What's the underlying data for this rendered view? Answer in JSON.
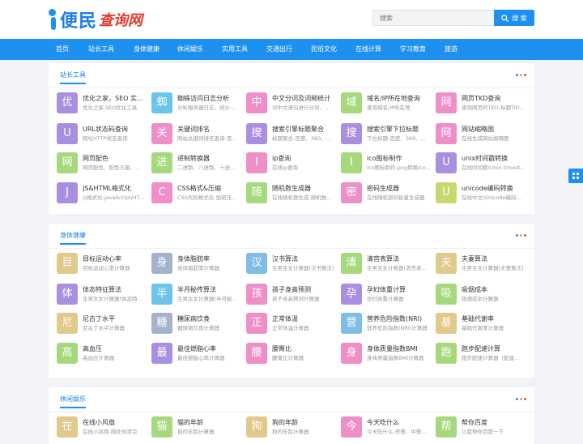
{
  "brand": {
    "logo_part1": "便民",
    "logo_part2": "查询网"
  },
  "search": {
    "placeholder": "搜索",
    "button_label": "搜 索"
  },
  "nav": [
    "首页",
    "站长工具",
    "身体健康",
    "休闲娱乐",
    "实用工具",
    "交通出行",
    "民俗文化",
    "在线计算",
    "学习教育",
    "旅游"
  ],
  "colors": {
    "primary": "#1e90f0",
    "dot1": "#1e90f0",
    "dot2": "#f5a623",
    "dot3": "#e84c3d"
  },
  "sections": [
    {
      "title": "站长工具",
      "items": [
        {
          "glyph": "优",
          "color": "#a98fe0",
          "name": "优化之家，SEO 实...",
          "desc": "优化之家,SEO优化工具"
        },
        {
          "glyph": "蜘",
          "color": "#6cc4e8",
          "name": "蜘蛛访问日志分析",
          "desc": "分析服务器日志，统计..."
        },
        {
          "glyph": "中",
          "color": "#ee8fc8",
          "name": "中文分词及词频统计",
          "desc": "对中文语句进行分词，..."
        },
        {
          "glyph": "域",
          "color": "#a6d87e",
          "name": "域名/IP所在地查询",
          "desc": "查询域名/IP所在地"
        },
        {
          "glyph": "网",
          "color": "#ee8fc8",
          "name": "网页TKD查询",
          "desc": "查询网页的TKD-标题Titl..."
        },
        {
          "glyph": "U",
          "color": "#a98fe0",
          "name": "URL状态码查询",
          "desc": "网址HTTP状态查询"
        },
        {
          "glyph": "关",
          "color": "#ee8fc8",
          "name": "关键词排名",
          "desc": "网站关键词排名查询-百..."
        },
        {
          "glyph": "搜",
          "color": "#a98fe0",
          "name": "搜索引擎标题聚合",
          "desc": "标题聚合-百度、360、..."
        },
        {
          "glyph": "搜",
          "color": "#a98fe0",
          "name": "搜索引擎下拉标题",
          "desc": "下拉标题-百度、360、..."
        },
        {
          "glyph": "网",
          "color": "#ee8fc8",
          "name": "网站缩略图",
          "desc": "在线生成网站缩略图"
        },
        {
          "glyph": "网",
          "color": "#a6d87e",
          "name": "网页配色",
          "desc": "网页配色、配色方案、..."
        },
        {
          "glyph": "进",
          "color": "#a6d87e",
          "name": "进制转换器",
          "desc": "二进制、八进制、十进..."
        },
        {
          "glyph": "I",
          "color": "#ee8fc8",
          "name": "ip查询",
          "desc": "在线ip查询"
        },
        {
          "glyph": "I",
          "color": "#a6d87e",
          "name": "ico图标制作",
          "desc": "ico图标制作-png转换ico..."
        },
        {
          "glyph": "U",
          "color": "#a98fe0",
          "name": "unix时间戳转换",
          "desc": "在线时间戳(Unix timest..."
        },
        {
          "glyph": "J",
          "color": "#a98fe0",
          "name": "JS&HTML格式化",
          "desc": "js格式化-JavaScript/HT..."
        },
        {
          "glyph": "C",
          "color": "#ee8fc8",
          "name": "CSS格式&压缩",
          "desc": "CSS代码格式化-加密压..."
        },
        {
          "glyph": "随",
          "color": "#a6d87e",
          "name": "随机数生成器",
          "desc": "在线随机数生成-随机数..."
        },
        {
          "glyph": "密",
          "color": "#ee8fc8",
          "name": "密码生成器",
          "desc": "在线随机密码批量生成器"
        },
        {
          "glyph": "U",
          "color": "#c8d86e",
          "name": "unicode编码转换",
          "desc": "在线中文/Unicode编码..."
        }
      ]
    },
    {
      "title": "身体健康",
      "items": [
        {
          "glyph": "目",
          "color": "#e0c98a",
          "name": "目标运动心率",
          "desc": "目标运动心率计算器"
        },
        {
          "glyph": "身",
          "color": "#a3b3cc",
          "name": "身体脂肪率",
          "desc": "身体脂肪率计算器"
        },
        {
          "glyph": "汉",
          "color": "#7fbde6",
          "name": "汉书算法",
          "desc": "生男生女计算器(汉书算法)"
        },
        {
          "glyph": "清",
          "color": "#a6d87e",
          "name": "清宫表算法",
          "desc": "生男生女计算器(清宫表..."
        },
        {
          "glyph": "夫",
          "color": "#e0c98a",
          "name": "夫妻算法",
          "desc": "生男生女计算器(夫妻算法)"
        },
        {
          "glyph": "体",
          "color": "#a98fe0",
          "name": "体态特征算法",
          "desc": "生男生女计算器(体态特..."
        },
        {
          "glyph": "半",
          "color": "#6cc4e8",
          "name": "半月秘传算法",
          "desc": "生男生女计算器(半月秘..."
        },
        {
          "glyph": "孩",
          "color": "#ee8fc8",
          "name": "孩子身高预测",
          "desc": "孩子身高预测计算器"
        },
        {
          "glyph": "孕",
          "color": "#a98fe0",
          "name": "孕妇体重计算",
          "desc": "孕妇体重计算器"
        },
        {
          "glyph": "吸",
          "color": "#a6d87e",
          "name": "吸烟成本",
          "desc": "吸烟成本计算器"
        },
        {
          "glyph": "尼",
          "color": "#e0c98a",
          "name": "尼古丁水平",
          "desc": "尼古丁水平计算器"
        },
        {
          "glyph": "糖",
          "color": "#a3b3cc",
          "name": "糖尿病饮食",
          "desc": "糖尿病饮食计算器"
        },
        {
          "glyph": "正",
          "color": "#ee8fc8",
          "name": "正常体温",
          "desc": "正常体温计算器"
        },
        {
          "glyph": "营",
          "color": "#7fbde6",
          "name": "营养危险指数(NRI)",
          "desc": "营养危险指数(NRI)计算器"
        },
        {
          "glyph": "基",
          "color": "#e0c98a",
          "name": "基础代谢率",
          "desc": "基础代谢率计算器"
        },
        {
          "glyph": "高",
          "color": "#a6d87e",
          "name": "高血压",
          "desc": "高血压计算器"
        },
        {
          "glyph": "最",
          "color": "#a98fe0",
          "name": "最佳燃脂心率",
          "desc": "最佳燃脂心率计算器"
        },
        {
          "glyph": "腰",
          "color": "#ee8fc8",
          "name": "腰臀比",
          "desc": "腰臀比计算器"
        },
        {
          "glyph": "身",
          "color": "#ee8fc8",
          "name": "身体质量指数BMI",
          "desc": "身体质量指数BMI计算器"
        },
        {
          "glyph": "跑",
          "color": "#a6d87e",
          "name": "跑步配速计算",
          "desc": "跑步配速计算器（配速..."
        }
      ]
    },
    {
      "title": "休闲娱乐",
      "items": [
        {
          "glyph": "在",
          "color": "#e0c98a",
          "name": "在线小风扇",
          "desc": "在线小风扇-网处你清凉"
        },
        {
          "glyph": "猫",
          "color": "#a6d87e",
          "name": "猫的年龄",
          "desc": "猫的年龄计算器"
        },
        {
          "glyph": "狗",
          "color": "#e0c98a",
          "name": "狗的年龄",
          "desc": "狗的年龄计算器"
        },
        {
          "glyph": "今",
          "color": "#ee8fc8",
          "name": "今天吃什么",
          "desc": "今天吃什么-早餐、中餐..."
        },
        {
          "glyph": "帮",
          "color": "#a6d87e",
          "name": "帮你百度",
          "desc": "让我帮你百度一下"
        }
      ]
    }
  ]
}
